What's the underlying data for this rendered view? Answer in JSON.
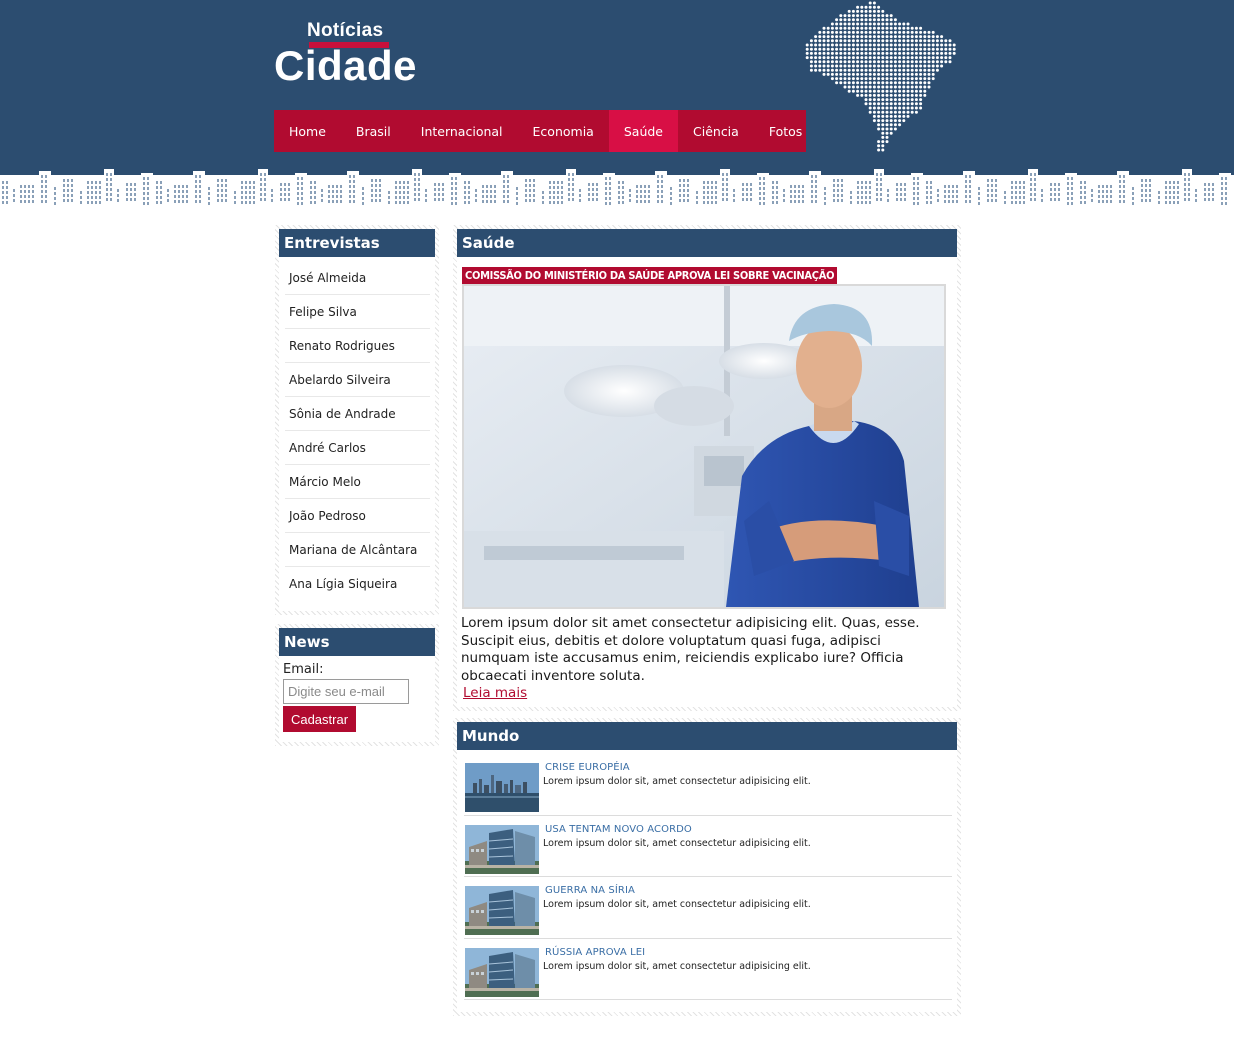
{
  "brand": {
    "small": "Notícias",
    "big": "Cidade"
  },
  "colors": {
    "header": "#2c4d70",
    "accent": "#b10b30",
    "accent_active": "#d80f45",
    "link": "#3a6ea5"
  },
  "nav": {
    "items": [
      {
        "label": "Home",
        "active": false
      },
      {
        "label": "Brasil",
        "active": false
      },
      {
        "label": "Internacional",
        "active": false
      },
      {
        "label": "Economia",
        "active": false
      },
      {
        "label": "Saúde",
        "active": true
      },
      {
        "label": "Ciência",
        "active": false
      },
      {
        "label": "Fotos",
        "active": false
      }
    ]
  },
  "entrevistas": {
    "title": "Entrevistas",
    "items": [
      "José Almeida",
      "Felipe Silva",
      "Renato Rodrigues",
      "Abelardo Silveira",
      "Sônia de Andrade",
      "André Carlos",
      "Márcio Melo",
      "João Pedroso",
      "Mariana de Alcântara",
      "Ana Lígia Siqueira"
    ]
  },
  "news": {
    "title": "News",
    "email_label": "Email:",
    "email_placeholder": "Digite seu e-mail",
    "email_value": "",
    "submit_label": "Cadastrar"
  },
  "saude": {
    "title": "Saúde",
    "headline": "COMISSÃO DO MINISTÉRIO DA SAÚDE APROVA LEI SOBRE VACINAÇÃO",
    "text": "Lorem ipsum dolor sit amet consectetur adipisicing elit. Quas, esse. Suscipit eius, debitis et dolore voluptatum quasi fuga, adipisci numquam iste accusamus enim, reiciendis explicabo iure? Officia obcaecati inventore soluta.",
    "more": "Leia mais"
  },
  "mundo": {
    "title": "Mundo",
    "items": [
      {
        "title": "CRISE EUROPÉIA",
        "desc": "Lorem ipsum dolor sit, amet consectetur adipisicing elit.",
        "thumb": "city-skyline-photo"
      },
      {
        "title": "USA TENTAM NOVO ACORDO",
        "desc": "Lorem ipsum dolor sit, amet consectetur adipisicing elit.",
        "thumb": "office-buildings-photo"
      },
      {
        "title": "GUERRA NA SÍRIA",
        "desc": "Lorem ipsum dolor sit, amet consectetur adipisicing elit.",
        "thumb": "office-buildings-photo"
      },
      {
        "title": "RÚSSIA APROVA LEI",
        "desc": "Lorem ipsum dolor sit, amet consectetur adipisicing elit.",
        "thumb": "office-buildings-photo"
      }
    ]
  }
}
